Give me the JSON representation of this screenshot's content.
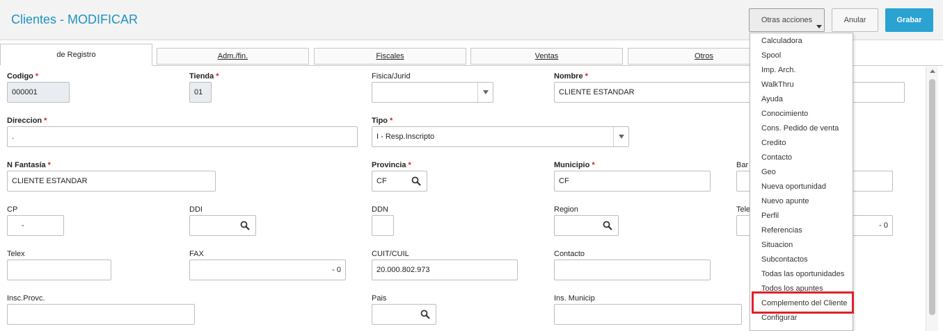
{
  "header": {
    "title": "Clientes - MODIFICAR",
    "otras_acciones": "Otras acciones",
    "anular": "Anular",
    "grabar": "Grabar"
  },
  "tabs": [
    "de Registro",
    "Adm./fin.",
    "Fiscales",
    "Ventas",
    "Otros"
  ],
  "form": {
    "codigo": {
      "label": "Codigo",
      "value": "000001"
    },
    "tienda": {
      "label": "Tienda",
      "value": "01"
    },
    "fisica": {
      "label": "Fisica/Jurid",
      "value": ""
    },
    "nombre": {
      "label": "Nombre",
      "value": "CLIENTE ESTANDAR"
    },
    "direccion": {
      "label": "Direccion",
      "value": "."
    },
    "tipo": {
      "label": "Tipo",
      "value": "I - Resp.Inscripto"
    },
    "n_fantasia": {
      "label": "N Fantasía",
      "value": "CLIENTE ESTANDAR"
    },
    "provincia": {
      "label": "Provincia",
      "value": "CF"
    },
    "municipio": {
      "label": "Municipio",
      "value": "CF"
    },
    "barrio": {
      "label": "Bar",
      "value": ""
    },
    "cp": {
      "label": "CP",
      "value": "-"
    },
    "ddi": {
      "label": "DDI",
      "value": ""
    },
    "ddn": {
      "label": "DDN",
      "value": ""
    },
    "region": {
      "label": "Region",
      "value": ""
    },
    "telefono": {
      "label": "Tele",
      "value": "-  0"
    },
    "telex": {
      "label": "Telex",
      "value": ""
    },
    "fax": {
      "label": "FAX",
      "value": "-  0"
    },
    "cuit": {
      "label": "CUIT/CUIL",
      "value": "20.000.802.973"
    },
    "contacto": {
      "label": "Contacto",
      "value": ""
    },
    "insc_provc": {
      "label": "Insc.Provc.",
      "value": ""
    },
    "pais": {
      "label": "Pais",
      "value": ""
    },
    "ins_municip": {
      "label": "Ins. Municip",
      "value": ""
    }
  },
  "menu": {
    "items": [
      "Calculadora",
      "Spool",
      "Imp. Arch.",
      "WalkThru",
      "Ayuda",
      "Conocimiento",
      "Cons. Pedido de venta",
      "Credito",
      "Contacto",
      "Geo",
      "Nueva oportunidad",
      "Nuevo apunte",
      "Perfil",
      "Referencias",
      "Situacion",
      "Subcontactos",
      "Todas las oportunidades",
      "Todos los apuntes",
      "Complemento del Cliente",
      "Configurar"
    ],
    "highlighted": "Complemento del Cliente"
  },
  "colors": {
    "accent": "#1e93c0",
    "primary_button": "#2aa2d2",
    "required": "#d12020",
    "highlight": "#e0202a"
  },
  "icons": {
    "search": "magnifier-icon",
    "dropdown": "chevron-down-icon"
  }
}
